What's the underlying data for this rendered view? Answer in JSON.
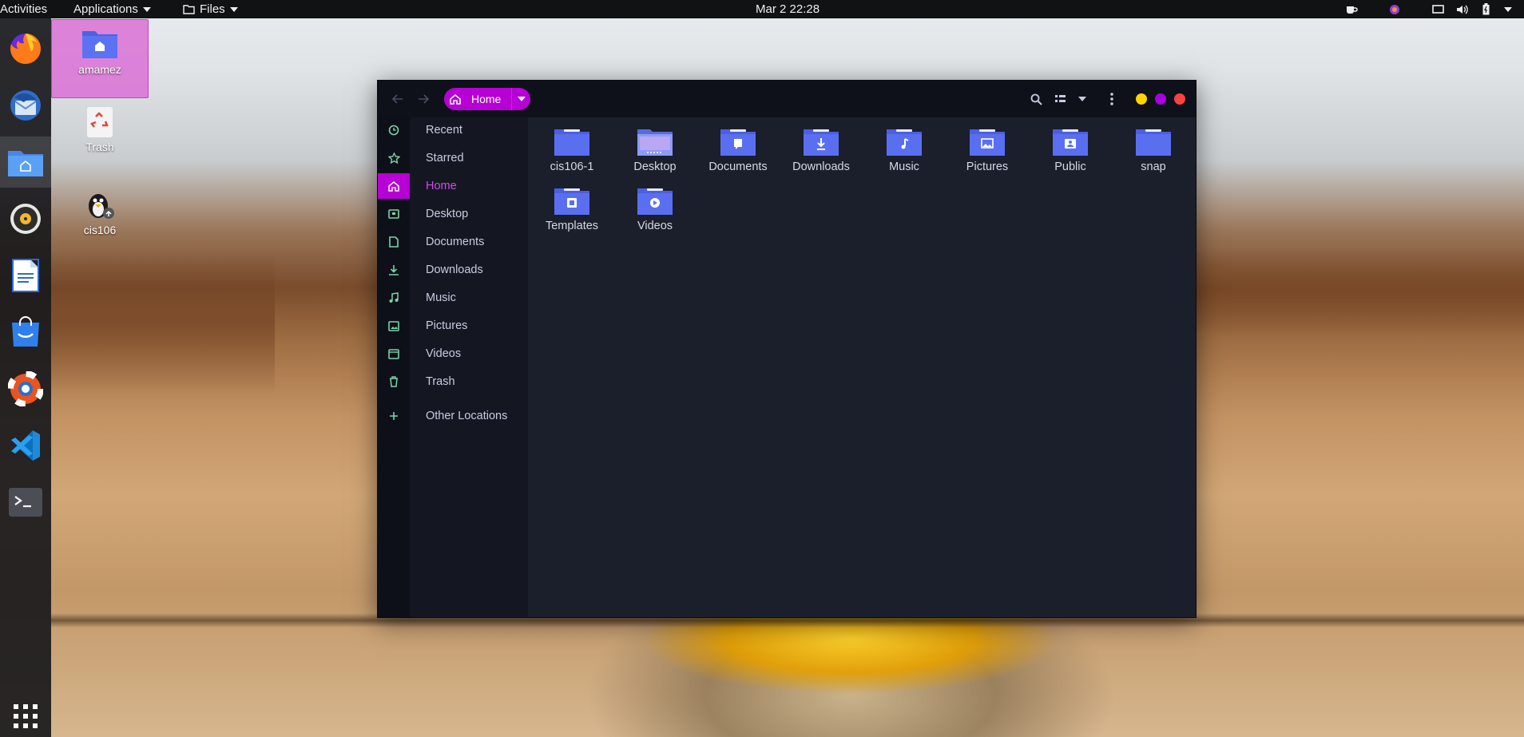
{
  "topbar": {
    "activities": "Activities",
    "applications": "Applications",
    "files_menu": "Files",
    "clock": "Mar 2  22:28",
    "tray_icons": [
      "coffee-icon",
      "color-app-icon",
      "screen-icon",
      "volume-icon",
      "battery-icon",
      "power-menu-caret-icon"
    ]
  },
  "dock": {
    "items": [
      "firefox-icon",
      "thunderbird-icon",
      "files-icon",
      "rhythmbox-icon",
      "writer-icon",
      "software-icon",
      "help-icon",
      "vscode-icon",
      "terminal-icon"
    ],
    "apps_grid": "show-applications-icon"
  },
  "desktop": {
    "icons": [
      {
        "label": "amamez",
        "icon": "home-folder-icon"
      },
      {
        "label": "Trash",
        "icon": "trash-icon"
      },
      {
        "label": "cis106",
        "icon": "linux-shortcut-icon"
      }
    ]
  },
  "window": {
    "path_label": "Home",
    "colors": {
      "accent": "#b700d6",
      "minimize": "#ffd400",
      "maximize": "#a800e0",
      "close": "#ff4040",
      "folder": "#5a6ff0"
    },
    "sidebar": [
      {
        "label": "Recent",
        "icon": "recent-icon"
      },
      {
        "label": "Starred",
        "icon": "star-icon"
      },
      {
        "label": "Home",
        "icon": "home-icon",
        "active": true
      },
      {
        "label": "Desktop",
        "icon": "desktop-icon"
      },
      {
        "label": "Documents",
        "icon": "document-icon"
      },
      {
        "label": "Downloads",
        "icon": "download-icon"
      },
      {
        "label": "Music",
        "icon": "music-icon"
      },
      {
        "label": "Pictures",
        "icon": "picture-icon"
      },
      {
        "label": "Videos",
        "icon": "video-icon"
      },
      {
        "label": "Trash",
        "icon": "trash-icon"
      },
      {
        "label": "Other Locations",
        "icon": "plus-icon"
      }
    ],
    "files": [
      {
        "label": "cis106-1",
        "icon": "folder-icon"
      },
      {
        "label": "Desktop",
        "icon": "desktop-folder-icon"
      },
      {
        "label": "Documents",
        "icon": "documents-folder-icon"
      },
      {
        "label": "Downloads",
        "icon": "downloads-folder-icon"
      },
      {
        "label": "Music",
        "icon": "music-folder-icon"
      },
      {
        "label": "Pictures",
        "icon": "pictures-folder-icon"
      },
      {
        "label": "Public",
        "icon": "public-folder-icon"
      },
      {
        "label": "snap",
        "icon": "folder-icon"
      },
      {
        "label": "Templates",
        "icon": "templates-folder-icon"
      },
      {
        "label": "Videos",
        "icon": "videos-folder-icon"
      }
    ]
  }
}
